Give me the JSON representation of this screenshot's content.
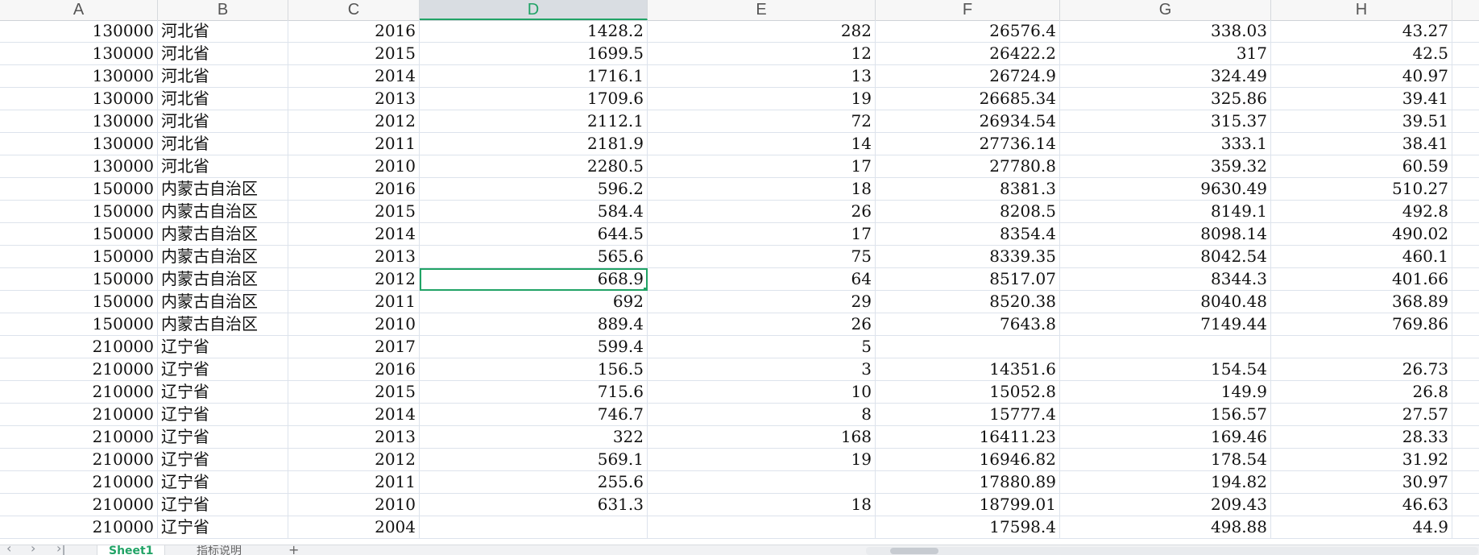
{
  "columns": [
    "A",
    "B",
    "C",
    "D",
    "E",
    "F",
    "G",
    "H"
  ],
  "selected_column": "D",
  "rows": [
    [
      "130000",
      "河北省",
      "2016",
      "1428.2",
      "282",
      "26576.4",
      "338.03",
      "43.27"
    ],
    [
      "130000",
      "河北省",
      "2015",
      "1699.5",
      "12",
      "26422.2",
      "317",
      "42.5"
    ],
    [
      "130000",
      "河北省",
      "2014",
      "1716.1",
      "13",
      "26724.9",
      "324.49",
      "40.97"
    ],
    [
      "130000",
      "河北省",
      "2013",
      "1709.6",
      "19",
      "26685.34",
      "325.86",
      "39.41"
    ],
    [
      "130000",
      "河北省",
      "2012",
      "2112.1",
      "72",
      "26934.54",
      "315.37",
      "39.51"
    ],
    [
      "130000",
      "河北省",
      "2011",
      "2181.9",
      "14",
      "27736.14",
      "333.1",
      "38.41"
    ],
    [
      "130000",
      "河北省",
      "2010",
      "2280.5",
      "17",
      "27780.8",
      "359.32",
      "60.59"
    ],
    [
      "150000",
      "内蒙古自治区",
      "2016",
      "596.2",
      "18",
      "8381.3",
      "9630.49",
      "510.27"
    ],
    [
      "150000",
      "内蒙古自治区",
      "2015",
      "584.4",
      "26",
      "8208.5",
      "8149.1",
      "492.8"
    ],
    [
      "150000",
      "内蒙古自治区",
      "2014",
      "644.5",
      "17",
      "8354.4",
      "8098.14",
      "490.02"
    ],
    [
      "150000",
      "内蒙古自治区",
      "2013",
      "565.6",
      "75",
      "8339.35",
      "8042.54",
      "460.1"
    ],
    [
      "150000",
      "内蒙古自治区",
      "2012",
      "668.9",
      "64",
      "8517.07",
      "8344.3",
      "401.66"
    ],
    [
      "150000",
      "内蒙古自治区",
      "2011",
      "692",
      "29",
      "8520.38",
      "8040.48",
      "368.89"
    ],
    [
      "150000",
      "内蒙古自治区",
      "2010",
      "889.4",
      "26",
      "7643.8",
      "7149.44",
      "769.86"
    ],
    [
      "210000",
      "辽宁省",
      "2017",
      "599.4",
      "5",
      "",
      "",
      ""
    ],
    [
      "210000",
      "辽宁省",
      "2016",
      "156.5",
      "3",
      "14351.6",
      "154.54",
      "26.73"
    ],
    [
      "210000",
      "辽宁省",
      "2015",
      "715.6",
      "10",
      "15052.8",
      "149.9",
      "26.8"
    ],
    [
      "210000",
      "辽宁省",
      "2014",
      "746.7",
      "8",
      "15777.4",
      "156.57",
      "27.57"
    ],
    [
      "210000",
      "辽宁省",
      "2013",
      "322",
      "168",
      "16411.23",
      "169.46",
      "28.33"
    ],
    [
      "210000",
      "辽宁省",
      "2012",
      "569.1",
      "19",
      "16946.82",
      "178.54",
      "31.92"
    ],
    [
      "210000",
      "辽宁省",
      "2011",
      "255.6",
      "",
      "17880.89",
      "194.82",
      "30.97"
    ],
    [
      "210000",
      "辽宁省",
      "2010",
      "631.3",
      "18",
      "18799.01",
      "209.43",
      "46.63"
    ],
    [
      "210000",
      "辽宁省",
      "2004",
      "",
      "",
      "17598.4",
      "498.88",
      "44.9"
    ]
  ],
  "active_cell": {
    "row": 11,
    "col": 3
  },
  "tabs": [
    {
      "label": "Sheet1",
      "active": true
    },
    {
      "label": "指标说明",
      "active": false
    }
  ],
  "tab_nav": [
    "‹",
    "›",
    "›|"
  ],
  "add_sheet_label": "+",
  "accent_color": "#21a366"
}
